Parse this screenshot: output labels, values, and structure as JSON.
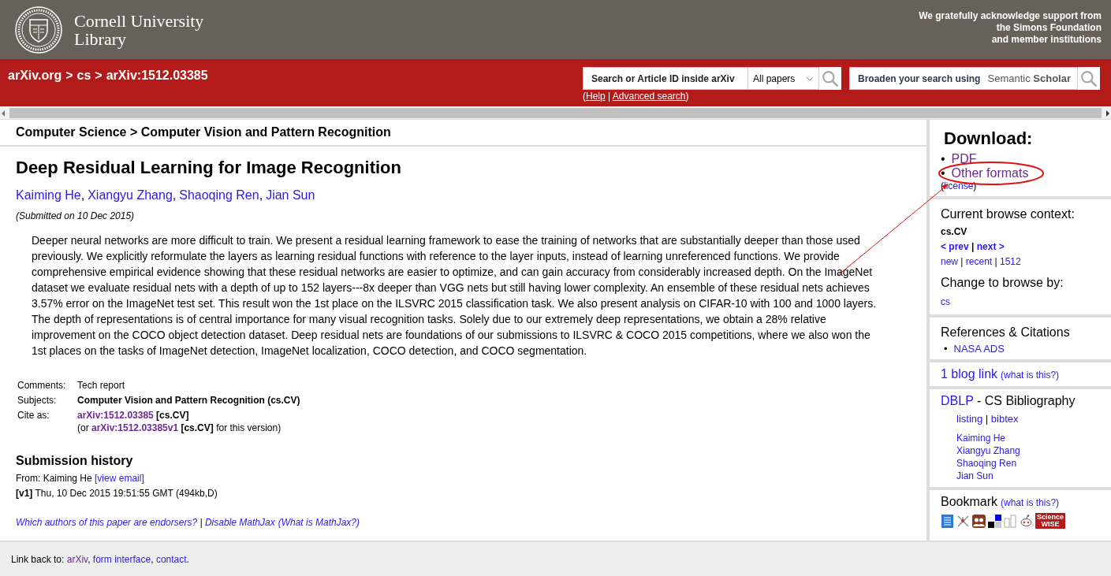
{
  "header": {
    "logo_lines": [
      "Cornell University",
      "Library"
    ],
    "support_lines": [
      "We gratefully acknowledge support from",
      "the Simons Foundation",
      "and member institutions"
    ]
  },
  "nav": {
    "breadcrumb": [
      "arXiv.org",
      "cs",
      "arXiv:1512.03385"
    ],
    "separator": ">",
    "search": {
      "placeholder": "Search or Article ID inside arXiv",
      "scope": "All papers"
    },
    "help": [
      {
        "kind": "text",
        "text": "("
      },
      {
        "kind": "link",
        "text": "Help"
      },
      {
        "kind": "text",
        "text": " | "
      },
      {
        "kind": "link",
        "text": "Advanced search"
      },
      {
        "kind": "text",
        "text": ")"
      }
    ],
    "broaden": {
      "label": "Broaden your search using",
      "brand": [
        "Semantic",
        "Scholar"
      ]
    }
  },
  "subject_path": "Computer Science > Computer Vision and Pattern Recognition",
  "title": "Deep Residual Learning for Image Recognition",
  "authors": [
    "Kaiming He",
    "Xiangyu Zhang",
    "Shaoqing Ren",
    "Jian Sun"
  ],
  "author_separator": ",",
  "submitted": "(Submitted on 10 Dec 2015)",
  "abstract": "Deeper neural networks are more difficult to train. We present a residual learning framework to ease the training of networks that are substantially deeper than those used previously. We explicitly reformulate the layers as learning residual functions with reference to the layer inputs, instead of learning unreferenced functions. We provide comprehensive empirical evidence showing that these residual networks are easier to optimize, and can gain accuracy from considerably increased depth. On the ImageNet dataset we evaluate residual nets with a depth of up to 152 layers---8x deeper than VGG nets but still having lower complexity. An ensemble of these residual nets achieves 3.57% error on the ImageNet test set. This result won the 1st place on the ILSVRC 2015 classification task. We also present analysis on CIFAR-10 with 100 and 1000 layers. The depth of representations is of central importance for many visual recognition tasks. Solely due to our extremely deep representations, we obtain a 28% relative improvement on the COCO object detection dataset. Deep residual nets are foundations of our submissions to ILSVRC & COCO 2015 competitions, where we also won the 1st places on the tasks of ImageNet detection, ImageNet localization, COCO detection, and COCO segmentation.",
  "metadata": [
    {
      "label": "Comments:",
      "lines": [
        [
          {
            "kind": "text",
            "text": "Tech report"
          }
        ]
      ]
    },
    {
      "label": "Subjects:",
      "lines": [
        [
          {
            "kind": "bold",
            "text": "Computer Vision and Pattern Recognition (cs.CV)"
          }
        ]
      ]
    },
    {
      "label": "Cite as:",
      "lines": [
        [
          {
            "kind": "bold-visited",
            "text": "arXiv:1512.03385"
          },
          {
            "kind": "bold",
            "text": " [cs.CV]"
          }
        ],
        [
          {
            "kind": "text",
            "text": "(or "
          },
          {
            "kind": "bold-visited",
            "text": "arXiv:1512.03385v1"
          },
          {
            "kind": "bold",
            "text": " [cs.CV]"
          },
          {
            "kind": "text",
            "text": " for this version)"
          }
        ]
      ]
    }
  ],
  "history": {
    "heading": "Submission history",
    "lines": [
      [
        {
          "kind": "text",
          "text": "From: Kaiming He "
        },
        {
          "kind": "link",
          "text": "[view email]"
        }
      ],
      [
        {
          "kind": "bold",
          "text": "[v1]"
        },
        {
          "kind": "text",
          "text": " Thu, 10 Dec 2015 19:51:55 GMT (494kb,D)"
        }
      ]
    ]
  },
  "endorsers": [
    {
      "kind": "link",
      "text": "Which authors of this paper are endorsers?"
    },
    {
      "kind": "text",
      "text": " | "
    },
    {
      "kind": "link",
      "text": "Disable MathJax"
    },
    {
      "kind": "spaced-link",
      "text": "(What is MathJax?)"
    }
  ],
  "sidebar": [
    {
      "kind": "download",
      "heading": "Download:",
      "bullet": "•",
      "items": [
        {
          "text": "PDF",
          "visited": true
        },
        {
          "text": "Other formats",
          "visited": true
        }
      ],
      "after": [
        {
          "kind": "text",
          "text": "("
        },
        {
          "kind": "link",
          "text": "license"
        },
        {
          "kind": "text",
          "text": ")"
        }
      ]
    },
    {
      "kind": "browse",
      "heading": "Current browse context:",
      "context": "cs.CV",
      "lines": [
        [
          {
            "kind": "bold-link",
            "text": "< prev"
          },
          {
            "kind": "bold",
            "text": " | "
          },
          {
            "kind": "bold-link",
            "text": "next >"
          }
        ],
        [
          {
            "kind": "link",
            "text": "new"
          },
          {
            "kind": "text",
            "text": " | "
          },
          {
            "kind": "link",
            "text": "recent"
          },
          {
            "kind": "text",
            "text": " | "
          },
          {
            "kind": "link",
            "text": "1512"
          }
        ]
      ],
      "change_heading": "Change to browse by:",
      "change_links": [
        "cs"
      ]
    },
    {
      "kind": "refs",
      "bullet": "•",
      "heading": "References & Citations",
      "items": [
        "NASA ADS"
      ]
    },
    {
      "kind": "blog",
      "line": [
        {
          "kind": "big-link",
          "text": "1 blog link"
        },
        {
          "kind": "spaced-link",
          "text": "(what is this?)"
        }
      ]
    },
    {
      "kind": "dblp",
      "line": [
        {
          "kind": "big-link",
          "text": "DBLP"
        },
        {
          "kind": "big",
          "text": " - CS Bibliography"
        }
      ],
      "links": [
        {
          "kind": "link",
          "text": "listing"
        },
        {
          "kind": "text",
          "text": " | "
        },
        {
          "kind": "link",
          "text": "bibtex"
        }
      ],
      "authors": [
        "Kaiming He",
        "Xiangyu Zhang",
        "Shaoqing Ren",
        "Jian Sun"
      ]
    },
    {
      "kind": "bookmark",
      "line": [
        {
          "kind": "big",
          "text": "Bookmark"
        },
        {
          "kind": "spaced-link",
          "text": "(what is this?)"
        }
      ],
      "badge": [
        "Science",
        "WISE"
      ]
    }
  ],
  "footer": [
    {
      "kind": "text",
      "text": "Link back to: "
    },
    {
      "kind": "visited",
      "text": "arXiv"
    },
    {
      "kind": "text",
      "text": ", "
    },
    {
      "kind": "link",
      "text": "form interface"
    },
    {
      "kind": "text",
      "text": ", "
    },
    {
      "kind": "link",
      "text": "contact"
    },
    {
      "kind": "text",
      "text": "."
    }
  ]
}
